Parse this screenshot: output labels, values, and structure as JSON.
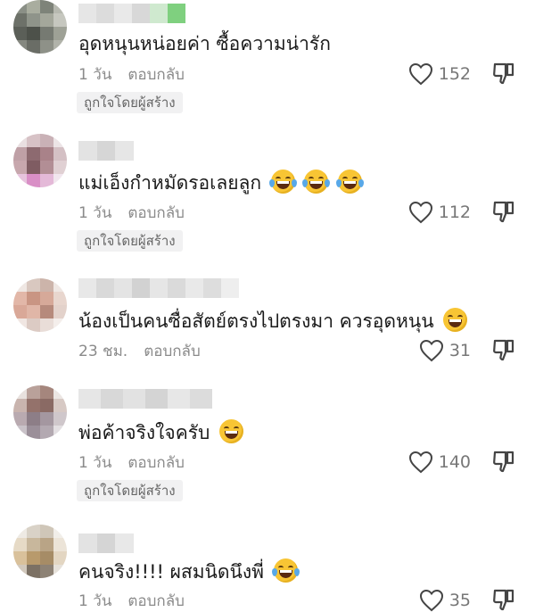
{
  "badge_label": "ถูกใจโดยผู้สร้าง",
  "reply_label": "ตอบกลับ",
  "comments": [
    {
      "text": "อุดหนุนหน่อยค่า ซื้อความน่ารัก",
      "emojis": [],
      "time": "1 วัน",
      "likes": "152",
      "creator_liked": true
    },
    {
      "text": "แม่เอ็งกำหมัดรอเลยลูก",
      "emojis": [
        "joy",
        "joy",
        "joy"
      ],
      "time": "1 วัน",
      "likes": "112",
      "creator_liked": true
    },
    {
      "text": "น้องเป็นคนซื่อสัตย์ตรงไปตรงมา ควรอุดหนุน",
      "emojis": [
        "grin"
      ],
      "time": "23 ชม.",
      "likes": "31",
      "creator_liked": false
    },
    {
      "text": "พ่อค้าจริงใจครับ",
      "emojis": [
        "grin"
      ],
      "time": "1 วัน",
      "likes": "140",
      "creator_liked": true
    },
    {
      "text": "คนจริง!!!! ผสมนิดนึงพี่",
      "emojis": [
        "joy"
      ],
      "time": "1 วัน",
      "likes": "35",
      "creator_liked": false
    }
  ],
  "colors": {
    "text": "#1a1a1a",
    "meta": "#8a8a8a",
    "badge_bg": "#f1f1f2"
  }
}
